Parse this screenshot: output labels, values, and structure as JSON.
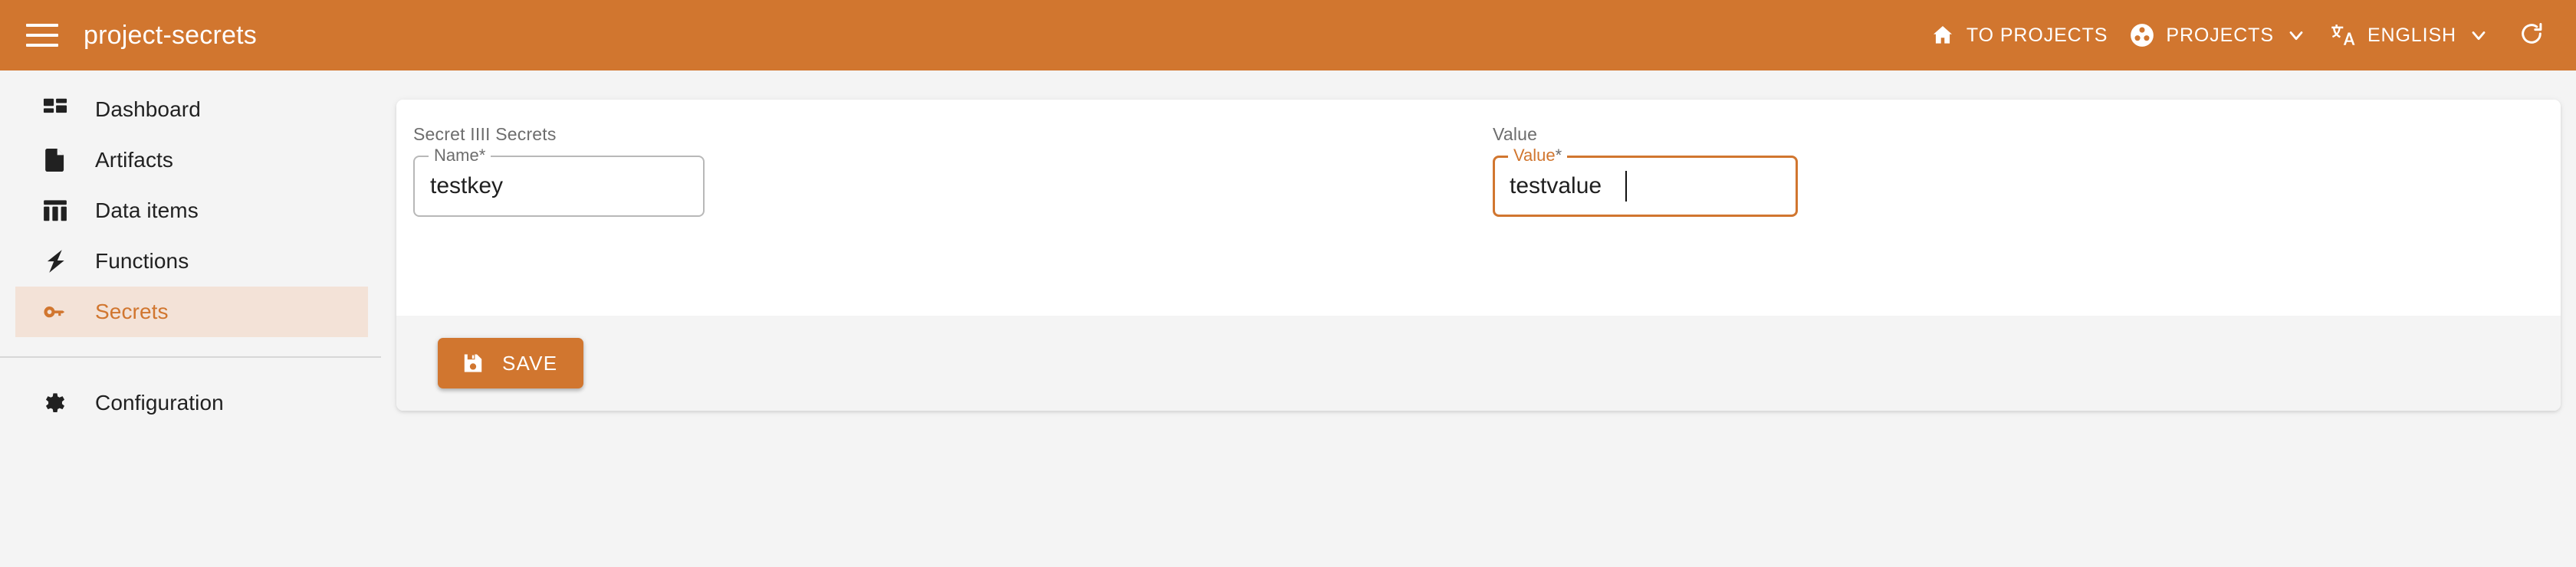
{
  "header": {
    "menu_icon": "hamburger-menu-icon",
    "title": "project-secrets",
    "actions": [
      {
        "icon": "home-icon",
        "label": "TO PROJECTS",
        "has_chevron": false
      },
      {
        "icon": "projects-hub-icon",
        "label": "PROJECTS",
        "has_chevron": true
      },
      {
        "icon": "translate-icon",
        "label": "ENGLISH",
        "has_chevron": true
      }
    ],
    "refresh_icon": "refresh-icon",
    "background_color": "#d1762f",
    "text_color": "#ffffff"
  },
  "sidebar": {
    "items": [
      {
        "icon": "dashboard-icon",
        "label": "Dashboard",
        "active": false
      },
      {
        "icon": "artifacts-file-icon",
        "label": "Artifacts",
        "active": false
      },
      {
        "icon": "data-items-table-icon",
        "label": "Data items",
        "active": false
      },
      {
        "icon": "functions-bolt-icon",
        "label": "Functions",
        "active": false
      },
      {
        "icon": "secrets-key-icon",
        "label": "Secrets",
        "active": true
      }
    ],
    "bottom_items": [
      {
        "icon": "gear-icon",
        "label": "Configuration",
        "active": false
      }
    ],
    "active_color": "#d1762f",
    "active_background": "#f3e2d7"
  },
  "main": {
    "name_section": {
      "caption": "Secret IIII Secrets",
      "field": {
        "label": "Name",
        "required_mark": "*",
        "value": "testkey",
        "placeholder": "Name",
        "focused": false
      }
    },
    "value_section": {
      "caption": "Value",
      "field": {
        "label": "Value",
        "required_mark": "*",
        "value": "testvalue",
        "placeholder": "Value",
        "focused": true
      }
    },
    "footer": {
      "save_icon": "save-floppy-icon",
      "save_label": "SAVE"
    }
  },
  "colors": {
    "accent": "#d1762f",
    "page_background": "#f4f4f4",
    "card_background": "#ffffff",
    "footer_background": "#f4f4f4"
  }
}
